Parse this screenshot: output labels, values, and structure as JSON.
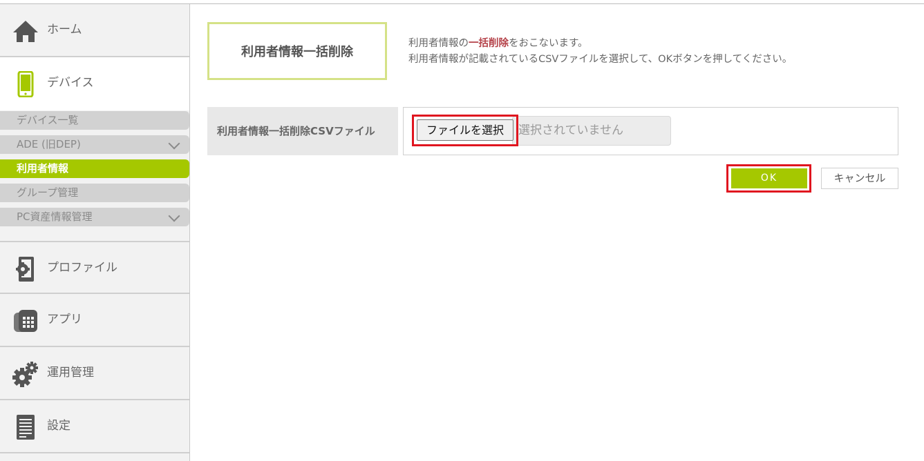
{
  "sidebar": {
    "nav": [
      {
        "label": "ホーム",
        "icon": "home-icon"
      },
      {
        "label": "デバイス",
        "icon": "smartphone-icon"
      },
      {
        "label": "プロファイル",
        "icon": "profile-icon"
      },
      {
        "label": "アプリ",
        "icon": "apps-icon"
      },
      {
        "label": "運用管理",
        "icon": "gears-icon"
      },
      {
        "label": "設定",
        "icon": "document-icon"
      }
    ],
    "sub": [
      {
        "label": "デバイス一覧"
      },
      {
        "label": "ADE (旧DEP)"
      },
      {
        "label": "利用者情報"
      },
      {
        "label": "グループ管理"
      },
      {
        "label": "PC資産情報管理"
      }
    ]
  },
  "main": {
    "title": "利用者情報一括削除",
    "desc": {
      "line1_pre": "利用者情報の",
      "line1_em": "一括削除",
      "line1_post": "をおこないます。",
      "line2": "利用者情報が記載されているCSVファイルを選択して、OKボタンを押してください。"
    },
    "form": {
      "label": "利用者情報一括削除CSVファイル",
      "file_button": "ファイルを選択",
      "file_status": "選択されていません"
    },
    "ok_label": "OK",
    "cancel_label": "キャンセル"
  },
  "colors": {
    "accent_green": "#a5c800",
    "highlight_red": "#e0151f",
    "emphasis_text": "#b5434a"
  }
}
